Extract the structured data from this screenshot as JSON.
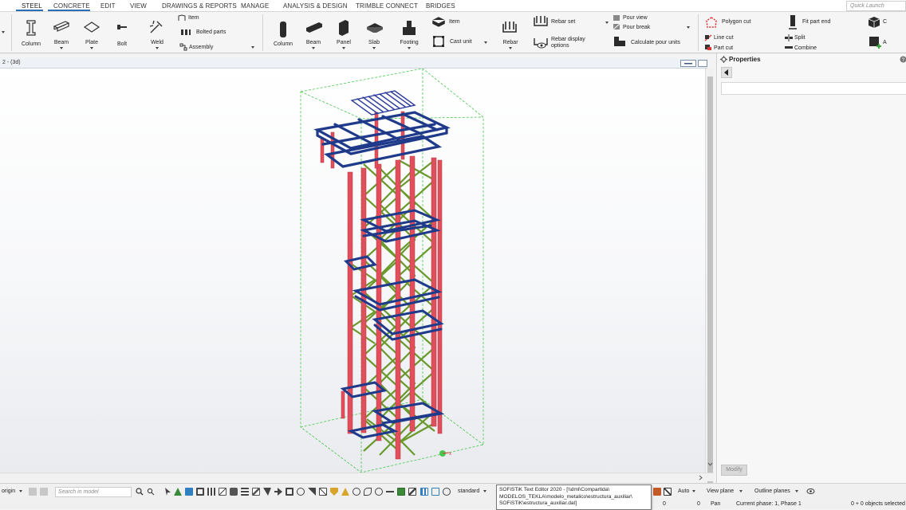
{
  "menu": {
    "tabs": [
      "STEEL",
      "CONCRETE",
      "EDIT",
      "VIEW",
      "DRAWINGS & REPORTS",
      "MANAGE",
      "ANALYSIS & DESIGN",
      "TRIMBLE CONNECT",
      "BRIDGES"
    ],
    "quick_launch_placeholder": "Quick Launch"
  },
  "ribbon": {
    "steel": {
      "column": "Column",
      "beam": "Beam",
      "plate": "Plate",
      "bolt": "Bolt",
      "weld": "Weld",
      "item": "Item",
      "bolted_parts": "Bolted parts",
      "assembly": "Assembly"
    },
    "concrete": {
      "column": "Column",
      "beam": "Beam",
      "panel": "Panel",
      "slab": "Slab",
      "footing": "Footing",
      "item": "Item",
      "cast_unit": "Cast unit",
      "rebar": "Rebar",
      "rebar_set": "Rebar set",
      "rebar_display_1": "Rebar display",
      "rebar_display_2": "options",
      "pour_view": "Pour view",
      "pour_break": "Pour break",
      "calculate_pour_units": "Calculate pour units"
    },
    "edit": {
      "polygon_cut": "Polygon cut",
      "line_cut": "Line cut",
      "part_cut": "Part cut",
      "fit_part_end": "Fit part end",
      "split": "Split",
      "combine": "Combine",
      "c_short": "C",
      "a_short": "A"
    }
  },
  "viewport": {
    "title": "2 - (3d)"
  },
  "properties": {
    "title": "Properties",
    "modify": "Modify"
  },
  "statusbar": {
    "origin": "origin",
    "search_placeholder": "Search in model",
    "standard": "standard",
    "tooltip_line1": "SOFiSTiK Text Editor 2020 - [\\\\dml\\Compartida\\",
    "tooltip_line2": "MODELOS_TEKLA\\modelo_metalico\\estructura_auxiliar\\",
    "tooltip_line3": "SOFiSTiK\\estructura_auxiliar.dat]",
    "auto": "Auto",
    "view_plane": "View plane",
    "outline_planes": "Outline planes",
    "zero1": "0",
    "zero2": "0",
    "pan": "Pan",
    "current_phase": "Current phase: 1, Phase 1",
    "selected": "0 + 0 objects selected"
  },
  "colors": {
    "column_red": "#e0505c",
    "beam_navy": "#1f3a8a",
    "brace_green": "#6a9a2e",
    "bbox_green": "#49c84f",
    "accent_blue": "#2a6fb5"
  }
}
